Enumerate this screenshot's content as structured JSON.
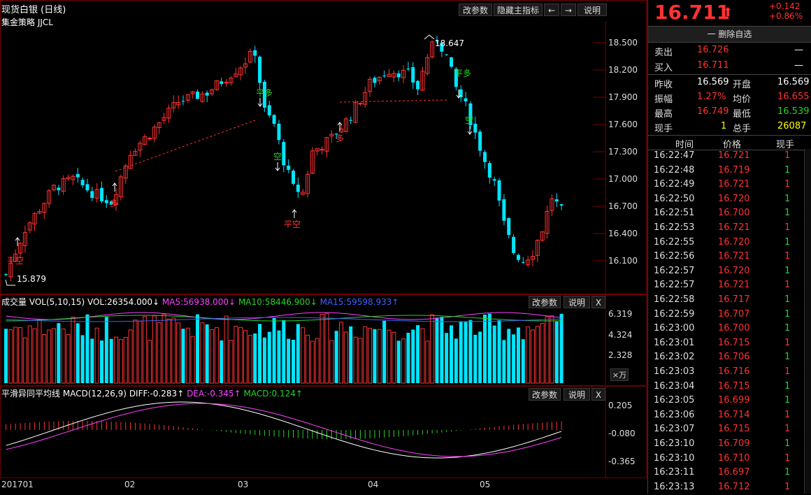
{
  "window_title": "现货白银 (日线)",
  "strategy_label": "集金策略 JJCL",
  "main_buttons": [
    "改参数",
    "隐藏主指标",
    "←",
    "→",
    "说明"
  ],
  "price_axis": [
    "18.500",
    "18.200",
    "17.900",
    "17.600",
    "17.300",
    "17.000",
    "16.700",
    "16.400",
    "16.100"
  ],
  "annotations": {
    "high": "18.647",
    "low": "15.879",
    "signals": [
      "平空",
      "多",
      "平多",
      "空",
      "平空",
      "多",
      "平多",
      "空"
    ]
  },
  "volume_panel": {
    "title": "成交量",
    "params": "VOL(5,10,15)",
    "vol": "VOL:26354.000↓",
    "ma5": "MA5:56938.000↓",
    "ma10": "MA10:58446.900↓",
    "ma15": "MA15:59598.933↑",
    "buttons": [
      "改参数",
      "说明",
      "X"
    ],
    "axis": [
      "6.319",
      "4.324",
      "2.328"
    ],
    "unit": "×万"
  },
  "macd_panel": {
    "title": "平滑异同平均线",
    "params": "MACD(12,26,9)",
    "diff": "DIFF:-0.283↑",
    "dea": "DEA:-0.345↑",
    "macd": "MACD:0.124↑",
    "buttons": [
      "改参数",
      "说明",
      "X"
    ],
    "axis": [
      "0.205",
      "-0.080",
      "-0.365"
    ]
  },
  "date_axis": [
    "201701",
    "02",
    "03",
    "04",
    "05"
  ],
  "quote": {
    "price": "16.711",
    "arrow": "⬆",
    "change": "+0.142",
    "change_pct": "+0.86%",
    "remove_watch": "一 删除自选",
    "sell_label": "卖出",
    "sell_price": "16.726",
    "sell_vol": "—",
    "buy_label": "买入",
    "buy_price": "16.711",
    "buy_vol": "—",
    "prev_close_label": "昨收",
    "prev_close": "16.569",
    "open_label": "开盘",
    "open": "16.569",
    "amplitude_label": "振幅",
    "amplitude": "1.27%",
    "avg_label": "均价",
    "avg": "16.655",
    "high_label": "最高",
    "high": "16.749",
    "low_label": "最低",
    "low": "16.539",
    "cur_vol_label": "现手",
    "cur_vol": "1",
    "total_vol_label": "总手",
    "total_vol": "26087"
  },
  "ticks_header": [
    "时间",
    "价格",
    "现手"
  ],
  "ticks": [
    {
      "time": "16:22:47",
      "price": "16.721",
      "vol": "1",
      "dir": "up"
    },
    {
      "time": "16:22:48",
      "price": "16.719",
      "vol": "1",
      "dir": "down"
    },
    {
      "time": "16:22:49",
      "price": "16.721",
      "vol": "1",
      "dir": "up"
    },
    {
      "time": "16:22:50",
      "price": "16.720",
      "vol": "1",
      "dir": "down"
    },
    {
      "time": "16:22:51",
      "price": "16.700",
      "vol": "1",
      "dir": "down"
    },
    {
      "time": "16:22:53",
      "price": "16.721",
      "vol": "1",
      "dir": "up"
    },
    {
      "time": "16:22:55",
      "price": "16.720",
      "vol": "1",
      "dir": "down"
    },
    {
      "time": "16:22:56",
      "price": "16.721",
      "vol": "1",
      "dir": "up"
    },
    {
      "time": "16:22:57",
      "price": "16.720",
      "vol": "1",
      "dir": "down"
    },
    {
      "time": "16:22:57",
      "price": "16.721",
      "vol": "1",
      "dir": "up"
    },
    {
      "time": "16:22:58",
      "price": "16.717",
      "vol": "1",
      "dir": "down"
    },
    {
      "time": "16:22:59",
      "price": "16.707",
      "vol": "1",
      "dir": "down"
    },
    {
      "time": "16:23:00",
      "price": "16.700",
      "vol": "1",
      "dir": "down"
    },
    {
      "time": "16:23:01",
      "price": "16.715",
      "vol": "1",
      "dir": "up"
    },
    {
      "time": "16:23:02",
      "price": "16.706",
      "vol": "1",
      "dir": "down"
    },
    {
      "time": "16:23:03",
      "price": "16.716",
      "vol": "1",
      "dir": "up"
    },
    {
      "time": "16:23:04",
      "price": "16.715",
      "vol": "1",
      "dir": "down"
    },
    {
      "time": "16:23:05",
      "price": "16.699",
      "vol": "1",
      "dir": "down"
    },
    {
      "time": "16:23:06",
      "price": "16.714",
      "vol": "1",
      "dir": "up"
    },
    {
      "time": "16:23:07",
      "price": "16.715",
      "vol": "1",
      "dir": "up"
    },
    {
      "time": "16:23:10",
      "price": "16.709",
      "vol": "1",
      "dir": "down"
    },
    {
      "time": "16:23:10",
      "price": "16.710",
      "vol": "1",
      "dir": "up"
    },
    {
      "time": "16:23:11",
      "price": "16.697",
      "vol": "1",
      "dir": "down"
    },
    {
      "time": "16:23:13",
      "price": "16.712",
      "vol": "1",
      "dir": "up"
    }
  ],
  "colors": {
    "up": "#ff3232",
    "down": "#00e5ff",
    "bg": "#000000",
    "border": "#6a0000"
  }
}
